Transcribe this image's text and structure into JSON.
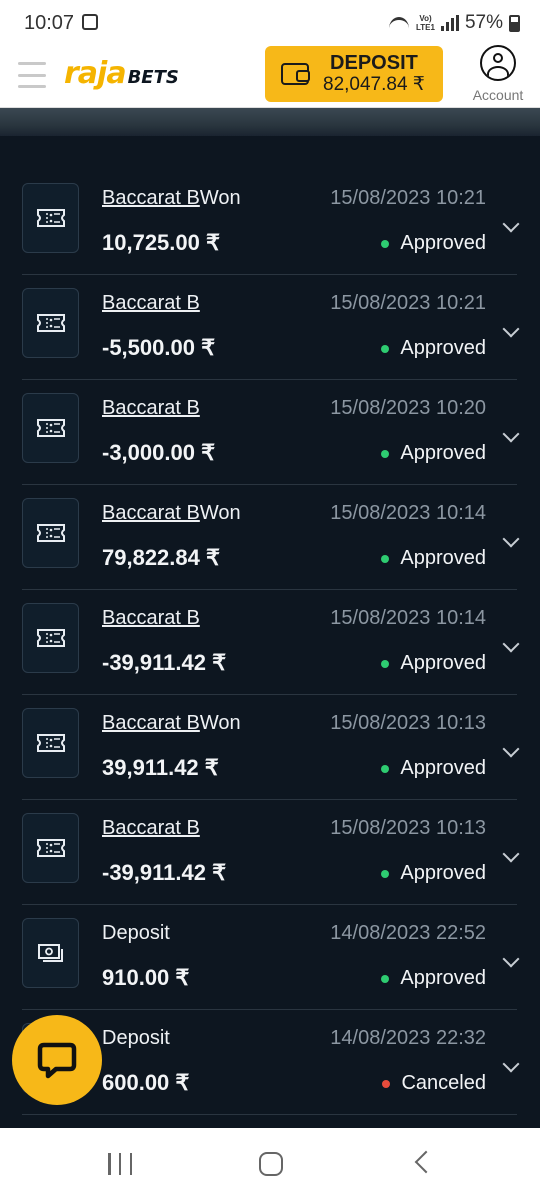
{
  "status_bar": {
    "time": "10:07",
    "network_label_top": "Vo)",
    "network_label_bottom": "LTE1",
    "battery_percent": "57%"
  },
  "header": {
    "logo_primary": "raja",
    "logo_secondary": "BETS",
    "deposit_label": "DEPOSIT",
    "balance": "82,047.84 ₹",
    "account_label": "Account"
  },
  "colors": {
    "accent": "#f7b818",
    "background": "#0d1620",
    "approved": "#2ecc71",
    "canceled": "#e74c3c"
  },
  "transactions": [
    {
      "icon": "ticket-icon",
      "title": "Baccarat B",
      "title_suffix": "Won",
      "amount": "10,725.00 ₹",
      "date": "15/08/2023 10:21",
      "status": "Approved"
    },
    {
      "icon": "ticket-icon",
      "title": "Baccarat B",
      "title_suffix": "",
      "amount": "-5,500.00 ₹",
      "date": "15/08/2023 10:21",
      "status": "Approved"
    },
    {
      "icon": "ticket-icon",
      "title": "Baccarat B",
      "title_suffix": "",
      "amount": "-3,000.00 ₹",
      "date": "15/08/2023 10:20",
      "status": "Approved"
    },
    {
      "icon": "ticket-icon",
      "title": "Baccarat B",
      "title_suffix": "Won",
      "amount": "79,822.84 ₹",
      "date": "15/08/2023 10:14",
      "status": "Approved"
    },
    {
      "icon": "ticket-icon",
      "title": "Baccarat B",
      "title_suffix": "",
      "amount": "-39,911.42 ₹",
      "date": "15/08/2023 10:14",
      "status": "Approved"
    },
    {
      "icon": "ticket-icon",
      "title": "Baccarat B",
      "title_suffix": "Won",
      "amount": "39,911.42 ₹",
      "date": "15/08/2023 10:13",
      "status": "Approved"
    },
    {
      "icon": "ticket-icon",
      "title": "Baccarat B",
      "title_suffix": "",
      "amount": "-39,911.42 ₹",
      "date": "15/08/2023 10:13",
      "status": "Approved"
    },
    {
      "icon": "cash-icon",
      "title": "Deposit",
      "title_suffix": "",
      "amount": "910.00 ₹",
      "date": "14/08/2023 22:52",
      "status": "Approved"
    },
    {
      "icon": "cash-icon",
      "title": "Deposit",
      "title_suffix": "",
      "amount": "600.00 ₹",
      "date": "14/08/2023 22:32",
      "status": "Canceled"
    }
  ]
}
